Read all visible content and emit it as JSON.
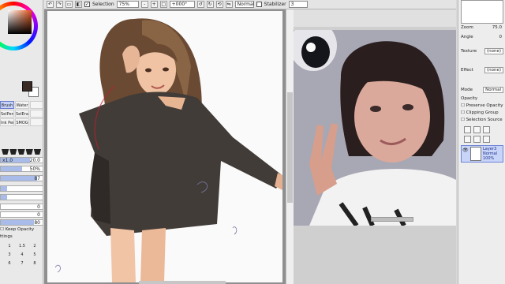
{
  "toolbar": {
    "selection_label": "Selection",
    "zoom_value": "75%",
    "angle_value": "+000°",
    "blend_mode": "Normal",
    "stabilizer_label": "Stabilizer",
    "stabilizer_value": "3",
    "selection_checked": true
  },
  "tools": {
    "items": [
      {
        "label": "Brush",
        "active": true
      },
      {
        "label": "Water",
        "active": false
      },
      {
        "label": "",
        "active": false
      },
      {
        "label": "SelPen",
        "active": false
      },
      {
        "label": "SelEras",
        "active": false
      },
      {
        "label": "",
        "active": false
      },
      {
        "label": "Ink Pen",
        "active": false
      },
      {
        "label": "SMOG",
        "active": false
      },
      {
        "label": "",
        "active": false
      }
    ]
  },
  "brush": {
    "size_label": "x1.0",
    "size_value": "20.0",
    "min_size_value": "50%",
    "density_value": "87",
    "row4_value": "0",
    "row5_value": "0",
    "row6_value": "80",
    "keep_opacity_label": "Keep Opacity",
    "settings_label": "ttings",
    "size_presets": [
      "1",
      "1.5",
      "2",
      "3",
      "4",
      "5",
      "6",
      "7",
      "8"
    ]
  },
  "layer_panel": {
    "zoom_label": "Zoom",
    "zoom_value": "75.0",
    "angle_label": "Angle",
    "angle_value": "0",
    "texture_label": "Texture",
    "texture_value": "(none)",
    "effect_label": "Effect",
    "effect_value": "(none)",
    "mode_label": "Mode",
    "mode_value": "Normal",
    "opacity_label": "Opacity",
    "preserve_opacity_label": "Preserve Opacity",
    "clipping_group_label": "Clipping Group",
    "selection_source_label": "Selection Source",
    "layer_name": "Layer3",
    "layer_mode": "Normal",
    "layer_opacity": "100%"
  },
  "colors": {
    "selection_blue": "#c9d5f8",
    "active_tool": "#c7d2f7",
    "main_color": "#3a2a24"
  }
}
